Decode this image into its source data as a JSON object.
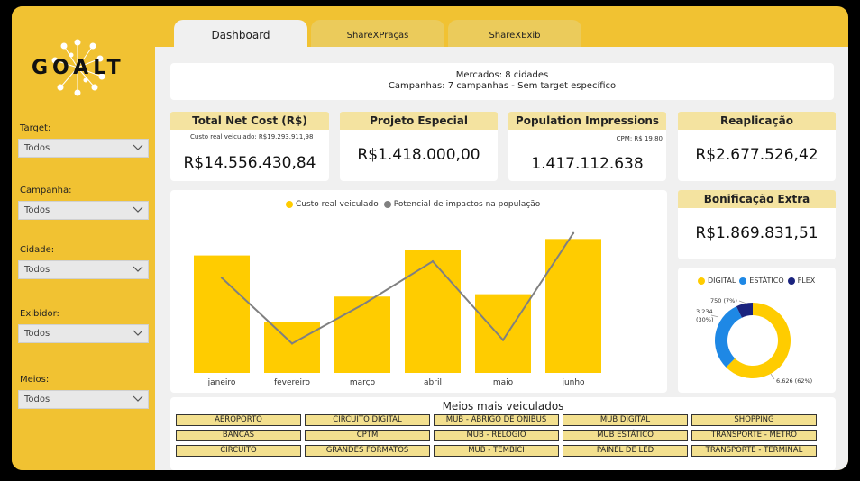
{
  "logo": {
    "text": "GOALT"
  },
  "filters": [
    {
      "label": "Target:",
      "value": "Todos"
    },
    {
      "label": "Campanha:",
      "value": "Todos"
    },
    {
      "label": "Cidade:",
      "value": "Todos"
    },
    {
      "label": "Exibidor:",
      "value": "Todos"
    },
    {
      "label": "Meios:",
      "value": "Todos"
    }
  ],
  "tabs": [
    "Dashboard",
    "ShareXPraças",
    "ShareXExib"
  ],
  "info": {
    "line1": "Mercados: 8 cidades",
    "line2": "Campanhas: 7 campanhas - Sem target específico"
  },
  "kpis": {
    "total_net_cost": {
      "title": "Total Net Cost (R$)",
      "sub": "Custo real veiculado: R$19.293.911,98",
      "value": "R$14.556.430,84"
    },
    "projeto_especial": {
      "title": "Projeto Especial",
      "value": "R$1.418.000,00"
    },
    "population_impressions": {
      "title": "Population Impressions",
      "sub": "CPM: R$ 19,80",
      "value": "1.417.112.638"
    },
    "reaplicacao": {
      "title": "Reaplicação",
      "value": "R$2.677.526,42"
    },
    "bonificacao": {
      "title": "Bonificação Extra",
      "value": "R$1.869.831,51"
    }
  },
  "colors": {
    "yellow": "#ffcc00",
    "line": "#808080",
    "digital": "#ffcc00",
    "estatico": "#1e88e5",
    "flex": "#1a237e"
  },
  "chart_data": [
    {
      "type": "bar",
      "categories": [
        "janeiro",
        "fevereiro",
        "março",
        "abril",
        "maio",
        "junho"
      ],
      "series": [
        {
          "name": "Custo real veiculado",
          "type": "bar",
          "values": [
            100,
            43,
            65,
            105,
            67,
            114
          ]
        },
        {
          "name": "Potencial de impactos na população",
          "type": "line",
          "values": [
            81,
            25,
            58,
            95,
            28,
            119
          ]
        }
      ],
      "ylim": [
        0,
        125
      ],
      "grid": false,
      "legend": "top"
    },
    {
      "type": "pie",
      "labels": [
        "DIGITAL",
        "ESTÁTICO",
        "FLEX"
      ],
      "values": [
        6626,
        3234,
        750
      ],
      "data_labels": [
        "6.626 (62%)",
        "3.234 (30%)",
        "750 (7%)"
      ],
      "legend": "top"
    }
  ],
  "meios": {
    "title": "Meios mais veiculados",
    "items": [
      "AEROPORTO",
      "CIRCUITO DIGITAL",
      "MUB - ABRIGO DE ONIBUS",
      "MUB DIGITAL",
      "SHOPPING",
      "BANCAS",
      "CPTM",
      "MUB - RELOGIO",
      "MUB ESTÁTICO",
      "TRANSPORTE - METRO",
      "CIRCUITO",
      "GRANDES FORMATOS",
      "MUB - TEMBICI",
      "PAINEL DE LED",
      "TRANSPORTE - TERMINAL"
    ]
  }
}
